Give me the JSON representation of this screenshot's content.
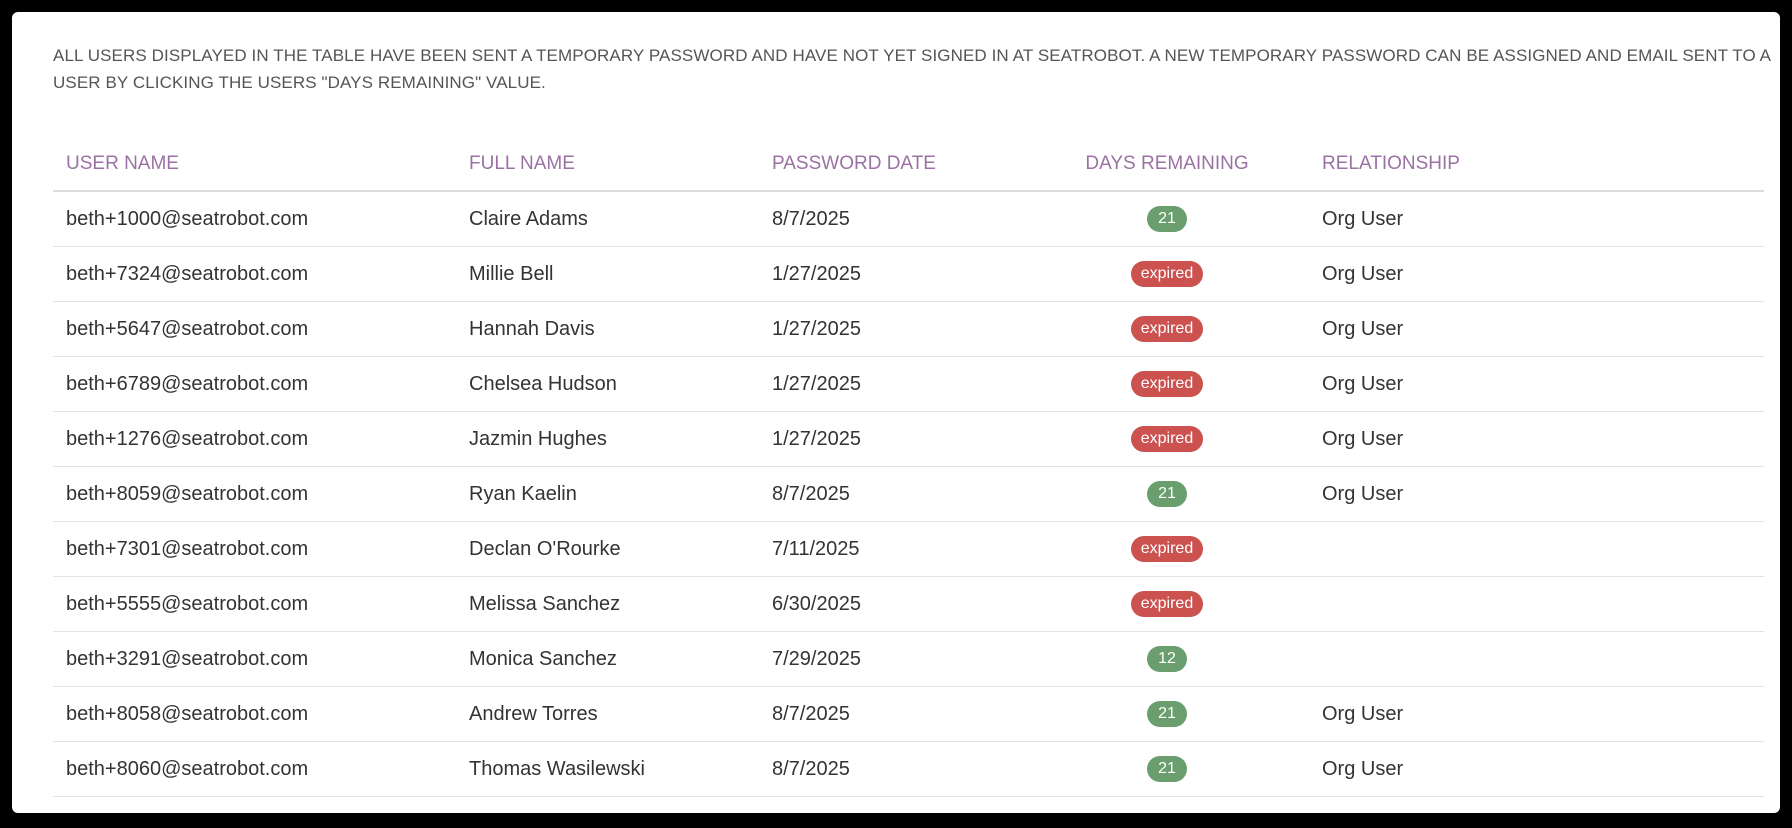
{
  "notice": "ALL USERS DISPLAYED IN THE TABLE HAVE BEEN SENT A TEMPORARY PASSWORD AND HAVE NOT YET SIGNED IN AT SEATROBOT. A NEW TEMPORARY PASSWORD CAN BE ASSIGNED AND EMAIL SENT TO A USER BY CLICKING THE USERS \"DAYS REMAINING\" VALUE.",
  "colors": {
    "header_text": "#9b71a3",
    "badge_ok": "#6b9e6e",
    "badge_expired": "#cc5250"
  },
  "table": {
    "headers": [
      "USER NAME",
      "FULL NAME",
      "PASSWORD DATE",
      "DAYS REMAINING",
      "RELATIONSHIP"
    ],
    "rows": [
      {
        "username": "beth+1000@seatrobot.com",
        "full_name": "Claire Adams",
        "password_date": "8/7/2025",
        "days_remaining": "21",
        "status": "ok",
        "relationship": "Org User"
      },
      {
        "username": "beth+7324@seatrobot.com",
        "full_name": "Millie Bell",
        "password_date": "1/27/2025",
        "days_remaining": "expired",
        "status": "expired",
        "relationship": "Org User"
      },
      {
        "username": "beth+5647@seatrobot.com",
        "full_name": "Hannah Davis",
        "password_date": "1/27/2025",
        "days_remaining": "expired",
        "status": "expired",
        "relationship": "Org User"
      },
      {
        "username": "beth+6789@seatrobot.com",
        "full_name": "Chelsea Hudson",
        "password_date": "1/27/2025",
        "days_remaining": "expired",
        "status": "expired",
        "relationship": "Org User"
      },
      {
        "username": "beth+1276@seatrobot.com",
        "full_name": "Jazmin Hughes",
        "password_date": "1/27/2025",
        "days_remaining": "expired",
        "status": "expired",
        "relationship": "Org User"
      },
      {
        "username": "beth+8059@seatrobot.com",
        "full_name": "Ryan Kaelin",
        "password_date": "8/7/2025",
        "days_remaining": "21",
        "status": "ok",
        "relationship": "Org User"
      },
      {
        "username": "beth+7301@seatrobot.com",
        "full_name": "Declan O'Rourke",
        "password_date": "7/11/2025",
        "days_remaining": "expired",
        "status": "expired",
        "relationship": ""
      },
      {
        "username": "beth+5555@seatrobot.com",
        "full_name": "Melissa Sanchez",
        "password_date": "6/30/2025",
        "days_remaining": "expired",
        "status": "expired",
        "relationship": ""
      },
      {
        "username": "beth+3291@seatrobot.com",
        "full_name": "Monica Sanchez",
        "password_date": "7/29/2025",
        "days_remaining": "12",
        "status": "ok",
        "relationship": ""
      },
      {
        "username": "beth+8058@seatrobot.com",
        "full_name": "Andrew Torres",
        "password_date": "8/7/2025",
        "days_remaining": "21",
        "status": "ok",
        "relationship": "Org User"
      },
      {
        "username": "beth+8060@seatrobot.com",
        "full_name": "Thomas Wasilewski",
        "password_date": "8/7/2025",
        "days_remaining": "21",
        "status": "ok",
        "relationship": "Org User"
      }
    ]
  }
}
